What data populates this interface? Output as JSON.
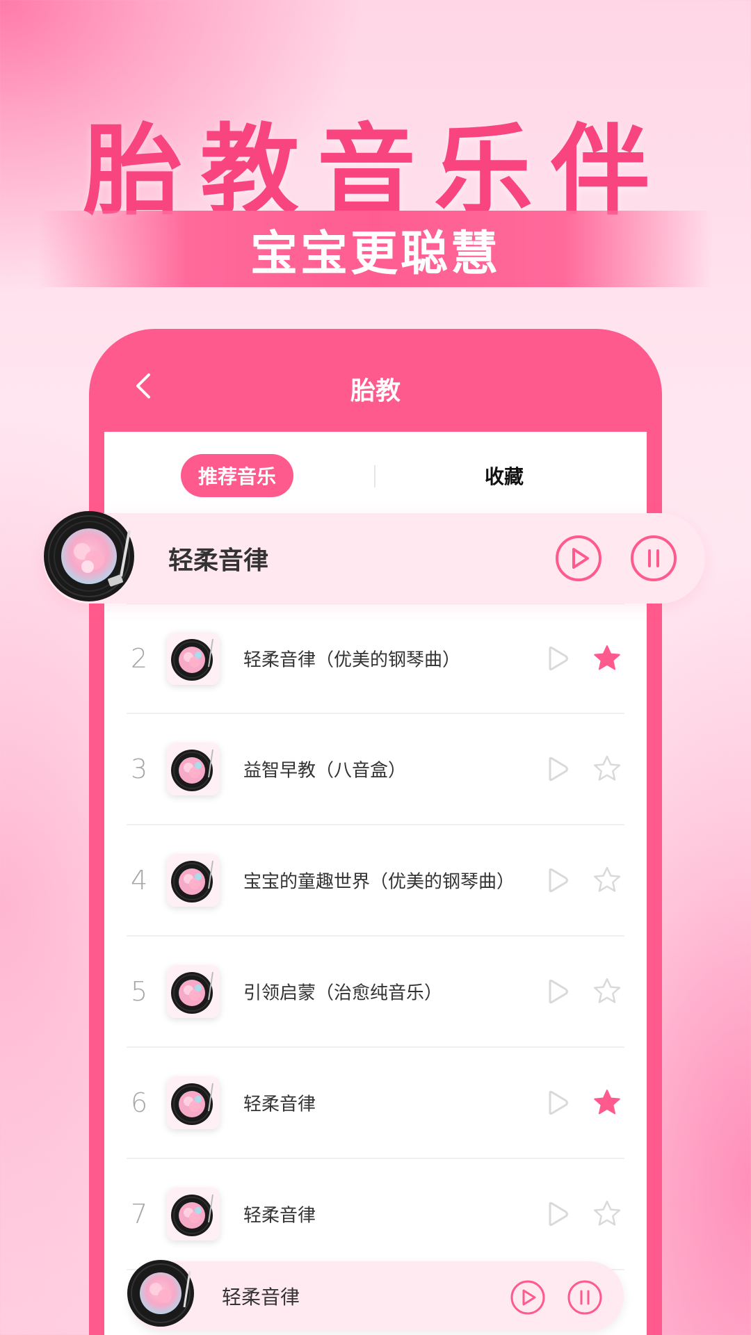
{
  "hero": {
    "title": "胎教音乐伴",
    "subtitle": "宝宝更聪慧"
  },
  "header": {
    "title": "胎教",
    "back_icon": "chevron-left-icon"
  },
  "tabs": {
    "recommend": "推荐音乐",
    "favorite": "收藏",
    "active": "推荐音乐"
  },
  "now_playing": {
    "title": "轻柔音律",
    "play_icon": "play-icon",
    "pause_icon": "pause-icon"
  },
  "tracks": [
    {
      "num": "2",
      "title": "轻柔音律（优美的钢琴曲）",
      "favorited": true
    },
    {
      "num": "3",
      "title": "益智早教（八音盒）",
      "favorited": false
    },
    {
      "num": "4",
      "title": "宝宝的童趣世界（优美的钢琴曲）",
      "favorited": false
    },
    {
      "num": "5",
      "title": "引领启蒙（治愈纯音乐）",
      "favorited": false
    },
    {
      "num": "6",
      "title": "轻柔音律",
      "favorited": true
    },
    {
      "num": "7",
      "title": "轻柔音律",
      "favorited": false
    }
  ],
  "mini_player": {
    "title": "轻柔音律"
  },
  "colors": {
    "accent": "#ff5a8d",
    "title_pink": "#f8457f",
    "star_inactive": "#d9d9d9",
    "play_inactive": "#d9d9d9"
  }
}
